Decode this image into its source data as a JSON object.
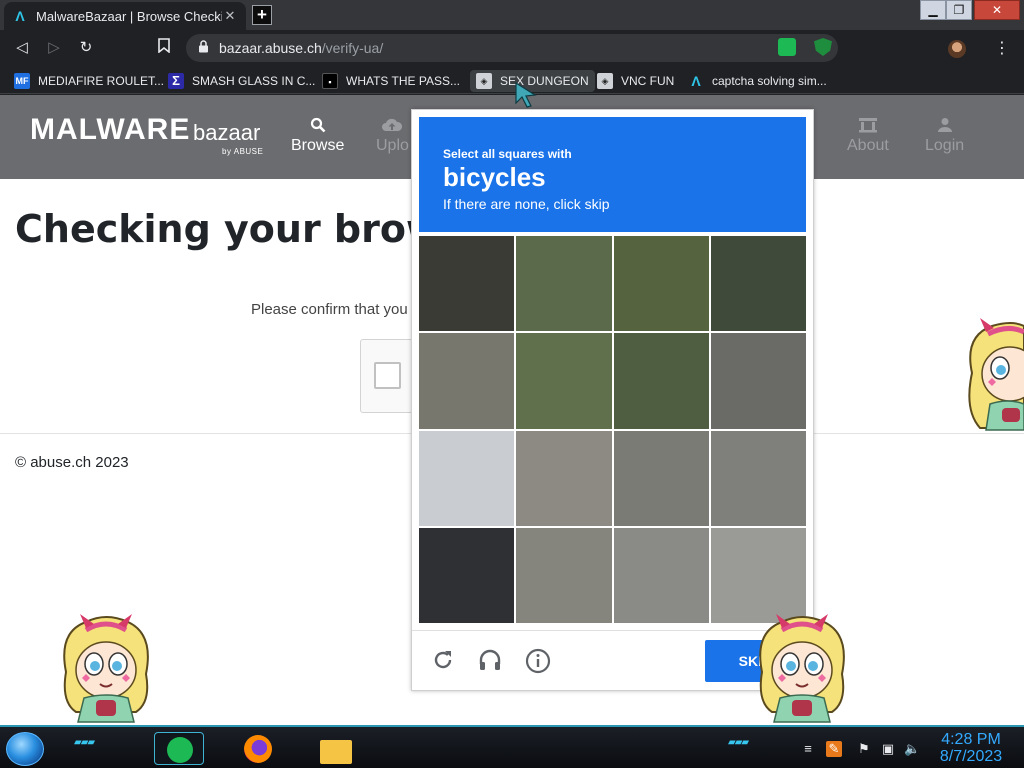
{
  "browser": {
    "tab_title": "MalwareBazaar | Browse Checking",
    "url_host": "bazaar.abuse.ch",
    "url_path": "/verify-ua/",
    "window_controls": {
      "minimize": "▁",
      "maximize": "❐",
      "close": "✕"
    }
  },
  "bookmarks": [
    {
      "label": "MEDIAFIRE ROULET...",
      "icon": "mediafire-icon"
    },
    {
      "label": "SMASH GLASS IN C...",
      "icon": "sigma-icon"
    },
    {
      "label": "WHATS THE PASS...",
      "icon": "terminal-icon"
    },
    {
      "label": "SEX DUNGEON",
      "icon": "dungeon-icon"
    },
    {
      "label": "VNC FUN",
      "icon": "dungeon-icon"
    },
    {
      "label": "captcha solving sim...",
      "icon": "arc-icon"
    }
  ],
  "site": {
    "logo_main": "MALWARE",
    "logo_sub": "bazaar",
    "logo_by": "by ABUSE",
    "nav": [
      {
        "label": "Browse",
        "icon": "search-icon"
      },
      {
        "label": "Uplo",
        "icon": "upload-icon"
      },
      {
        "label": "About",
        "icon": "bank-icon"
      },
      {
        "label": "Login",
        "icon": "user-icon"
      }
    ],
    "page_title": "Checking your browse",
    "confirm_text": "Please confirm that you",
    "copyright": "© abuse.ch 2023"
  },
  "captcha": {
    "instruction_line1": "Select all squares with",
    "target_object": "bicycles",
    "instruction_line3": "If there are none, click skip",
    "skip_label": "SKIP",
    "footer_icons": [
      "reload-icon",
      "audio-icon",
      "info-icon"
    ],
    "tile_count": 16
  },
  "taskbar": {
    "apps": [
      "spotify-icon",
      "firefox-icon",
      "file-explorer-icon"
    ],
    "time": "4:28 PM",
    "date": "8/7/2023"
  }
}
